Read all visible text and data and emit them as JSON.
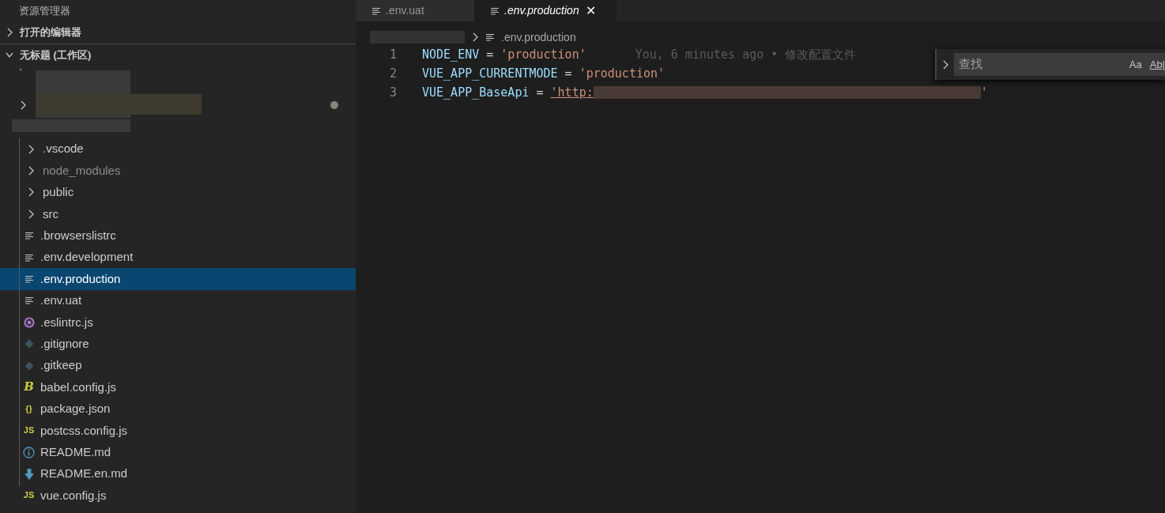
{
  "sidebar": {
    "title": "资源管理器",
    "sections": [
      {
        "label": "打开的编辑器",
        "expanded": false
      },
      {
        "label": "无标题 (工作区)",
        "expanded": true
      }
    ],
    "workspace_mark": "`",
    "files": [
      {
        "kind": "folder",
        "name": ".vscode",
        "expanded": false,
        "selected": false,
        "ignored": false
      },
      {
        "kind": "folder",
        "name": "node_modules",
        "expanded": false,
        "selected": false,
        "ignored": true
      },
      {
        "kind": "folder",
        "name": "public",
        "expanded": false,
        "selected": false,
        "ignored": false
      },
      {
        "kind": "folder",
        "name": "src",
        "expanded": false,
        "selected": false,
        "ignored": false
      },
      {
        "kind": "text",
        "name": ".browserslistrc",
        "selected": false,
        "ignored": false
      },
      {
        "kind": "text",
        "name": ".env.development",
        "selected": false,
        "ignored": false
      },
      {
        "kind": "text",
        "name": ".env.production",
        "selected": true,
        "ignored": false
      },
      {
        "kind": "text",
        "name": ".env.uat",
        "selected": false,
        "ignored": false
      },
      {
        "kind": "eslint",
        "name": ".eslintrc.js",
        "selected": false,
        "ignored": false
      },
      {
        "kind": "git",
        "name": ".gitignore",
        "selected": false,
        "ignored": false
      },
      {
        "kind": "git",
        "name": ".gitkeep",
        "selected": false,
        "ignored": false
      },
      {
        "kind": "glyph",
        "glyph": "B",
        "color": "#cbcb41",
        "name": "babel.config.js",
        "selected": false,
        "ignored": false
      },
      {
        "kind": "glyph",
        "glyph": "{}",
        "color": "#cbcb41",
        "name": "package.json",
        "selected": false,
        "ignored": false
      },
      {
        "kind": "glyph",
        "glyph": "JS",
        "color": "#cbcb41",
        "name": "postcss.config.js",
        "selected": false,
        "ignored": false
      },
      {
        "kind": "info",
        "name": "README.md",
        "selected": false,
        "ignored": false
      },
      {
        "kind": "download",
        "name": "README.en.md",
        "selected": false,
        "ignored": false
      },
      {
        "kind": "glyph",
        "glyph": "JS",
        "color": "#cbcb41",
        "name": "vue.config.js",
        "selected": false,
        "ignored": false
      }
    ]
  },
  "tabs": [
    {
      "label": ".env.uat",
      "selected": false
    },
    {
      "label": ".env.production",
      "selected": true,
      "close": "✕"
    }
  ],
  "breadcrumb": {
    "file": ".env.production"
  },
  "code": [
    {
      "number": "1",
      "key": "NODE_ENV",
      "op": " = ",
      "value": "'production'",
      "blame": "You, 6 minutes ago • 修改配置文件"
    },
    {
      "number": "2",
      "key": "VUE_APP_CURRENTMODE",
      "op": " = ",
      "value": "'production'"
    },
    {
      "number": "3",
      "key": "VUE_APP_BaseApi",
      "op": " = ",
      "value": "'http:",
      "redacted": true,
      "value_end": "'"
    }
  ],
  "find": {
    "placeholder": "查找",
    "options": [
      "Aa",
      "Ab|"
    ]
  }
}
